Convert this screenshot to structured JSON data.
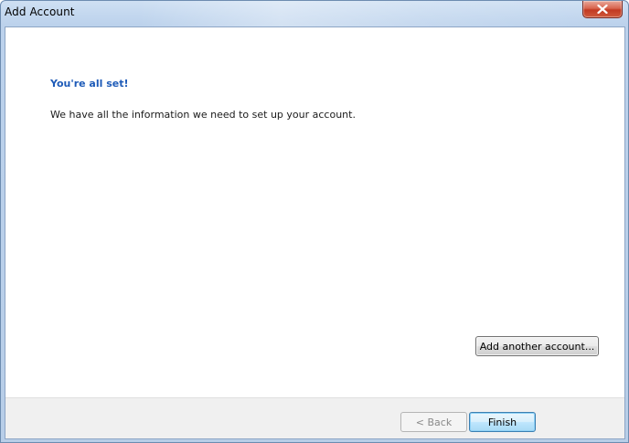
{
  "window": {
    "title": "Add Account",
    "close_icon": "close-icon"
  },
  "main": {
    "heading": "You're all set!",
    "message": "We have all the information we need to set up your account.",
    "add_another_label": "Add another account..."
  },
  "footer": {
    "back_label": "< Back",
    "back_enabled": false,
    "finish_label": "Finish"
  },
  "colors": {
    "heading": "#1e5bb8",
    "close_button": "#c23a22",
    "footer_background": "#f0f0f0"
  }
}
